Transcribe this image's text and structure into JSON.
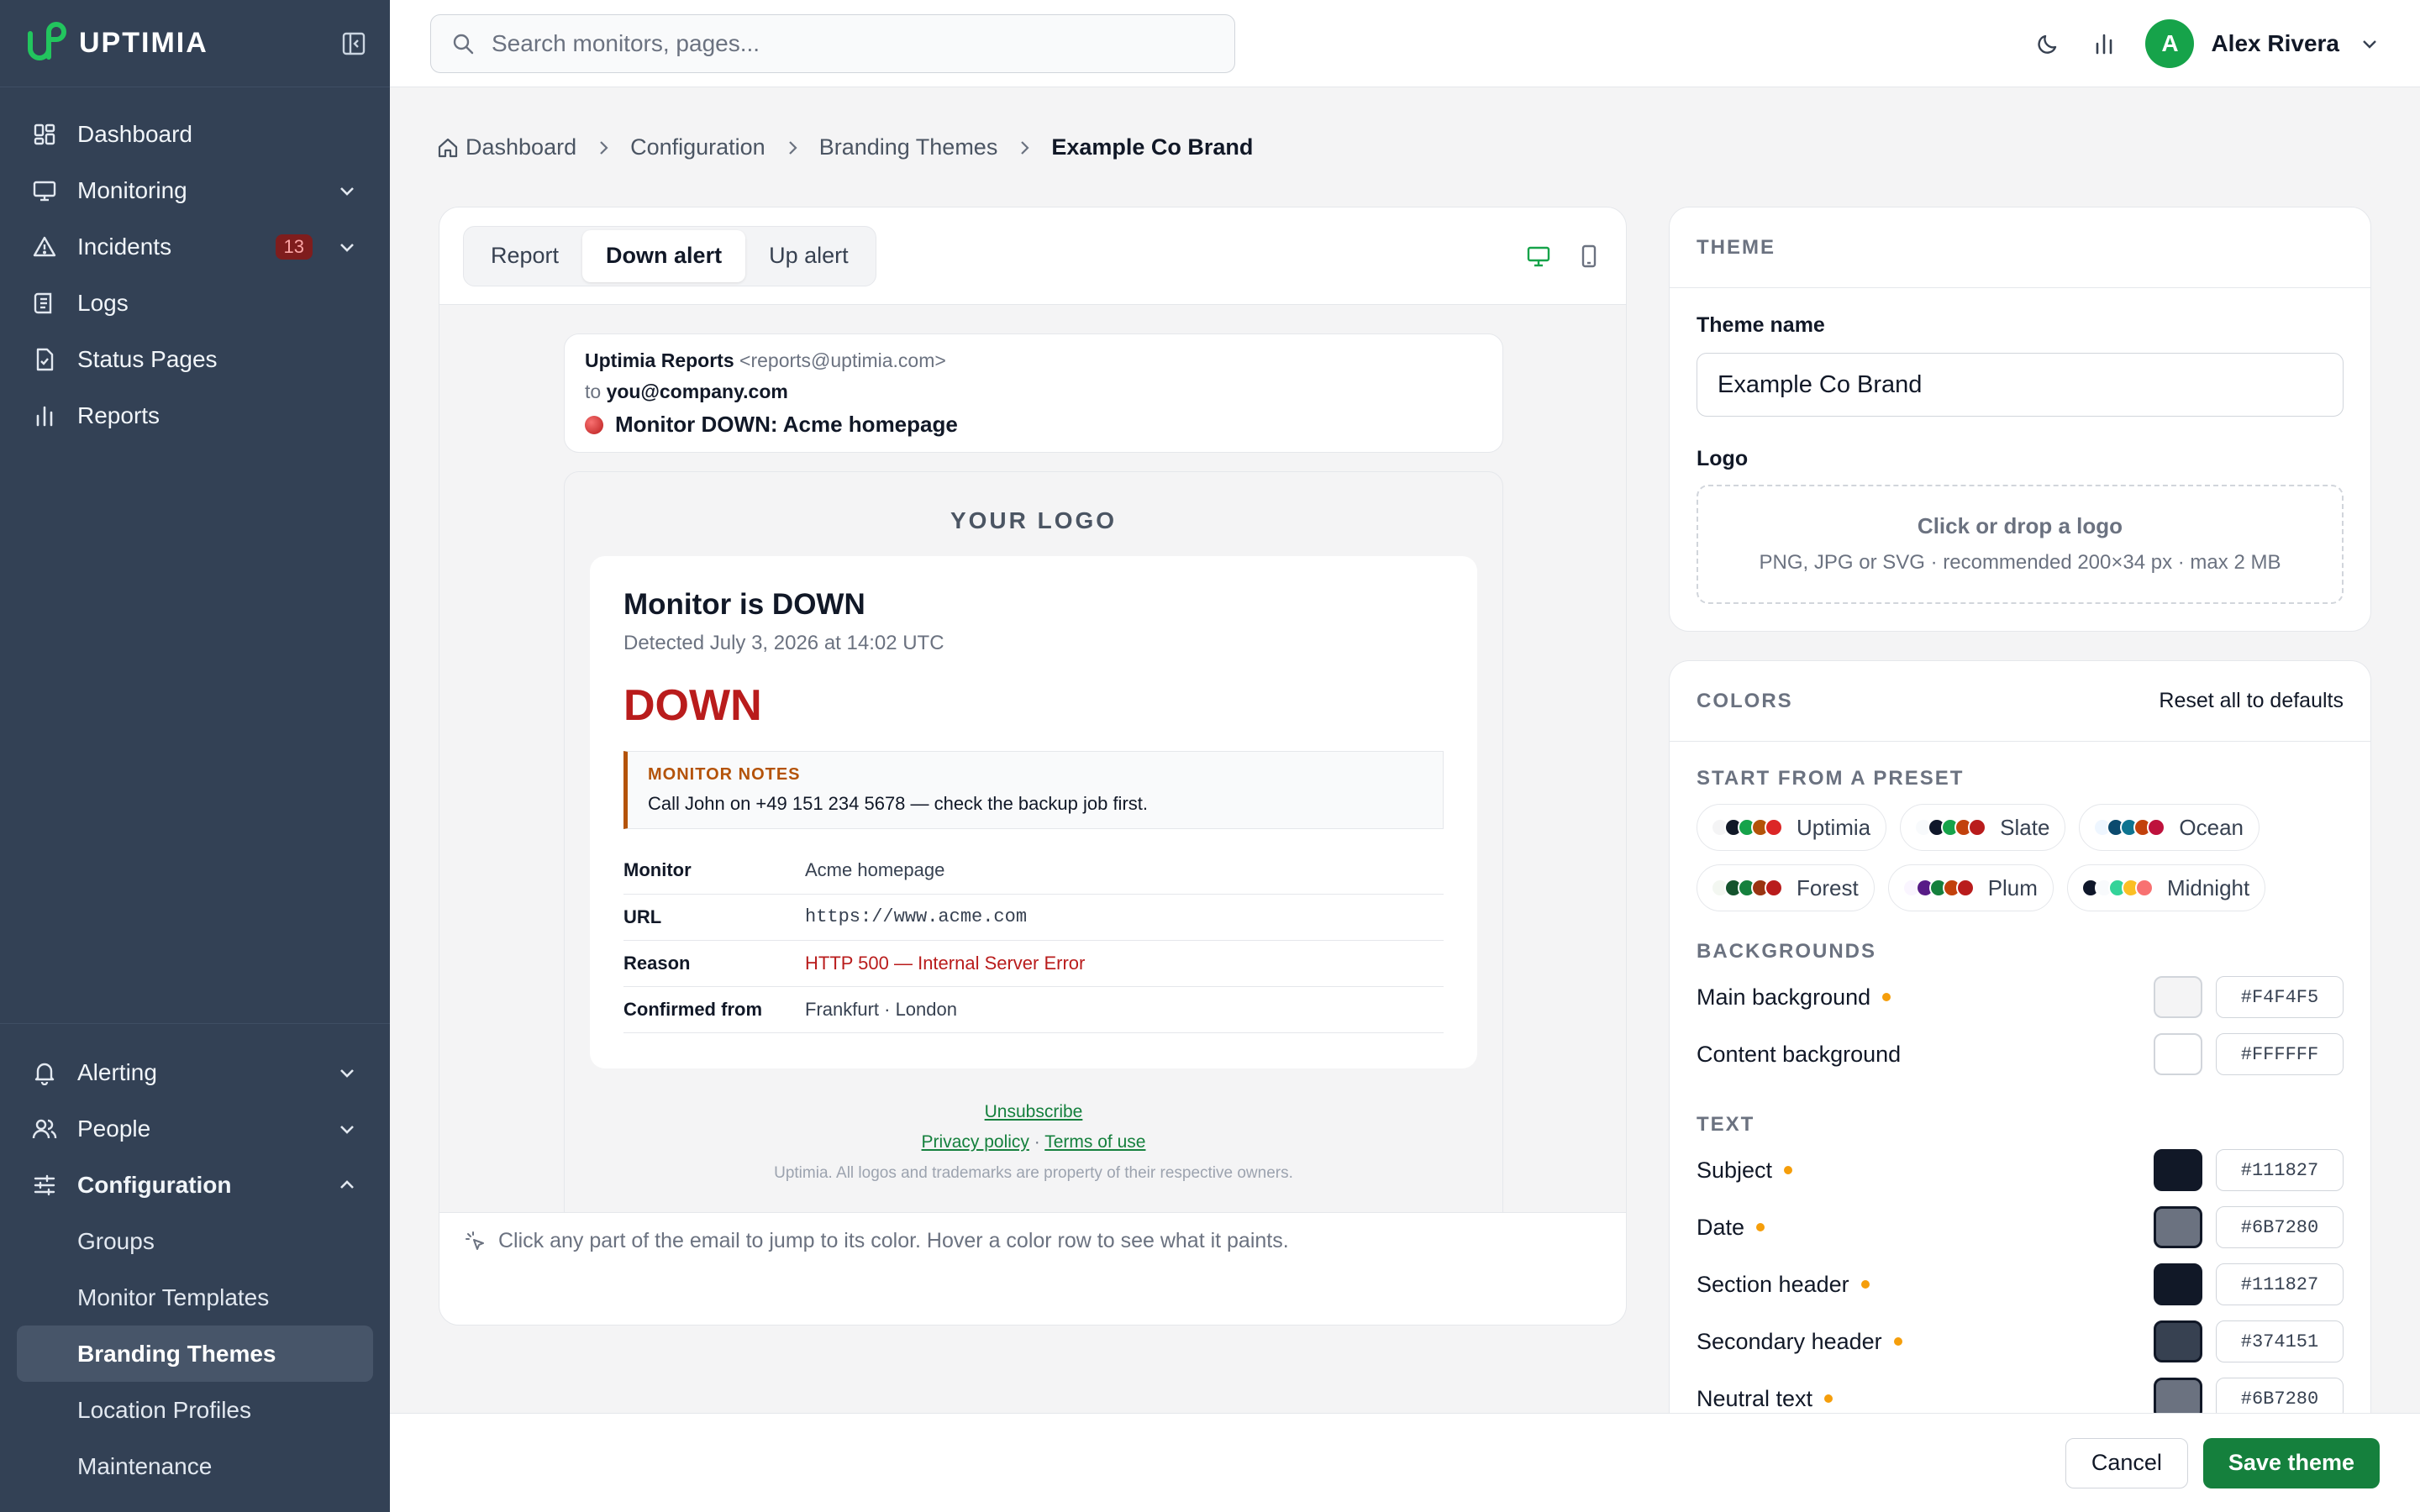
{
  "app": {
    "name": "UPTIMIA"
  },
  "sidebar": {
    "items": [
      {
        "label": "Dashboard",
        "icon": "dashboard-icon"
      },
      {
        "label": "Monitoring",
        "icon": "monitor-icon"
      },
      {
        "label": "Incidents",
        "icon": "warning-icon",
        "badge": "13"
      },
      {
        "label": "Logs",
        "icon": "logs-icon"
      },
      {
        "label": "Status Pages",
        "icon": "status-page-icon"
      },
      {
        "label": "Reports",
        "icon": "bar-chart-icon"
      }
    ],
    "bottom": [
      {
        "label": "Alerting",
        "icon": "bell-icon"
      },
      {
        "label": "People",
        "icon": "people-icon"
      },
      {
        "label": "Configuration",
        "icon": "sliders-icon"
      }
    ],
    "config_sub": [
      "Groups",
      "Monitor Templates",
      "Branding Themes",
      "Location Profiles",
      "Maintenance"
    ]
  },
  "topbar": {
    "search_placeholder": "Search monitors, pages...",
    "user_initial": "A",
    "user_name": "Alex Rivera"
  },
  "breadcrumb": [
    "Dashboard",
    "Configuration",
    "Branding Themes",
    "Example Co Brand"
  ],
  "preview": {
    "tabs": [
      "Report",
      "Down alert",
      "Up alert"
    ],
    "active_tab": "Down alert",
    "from_name": "Uptimia Reports",
    "from_email": "<reports@uptimia.com>",
    "to_prefix": "to",
    "to_email": "you@company.com",
    "subject": "Monitor DOWN: Acme homepage",
    "logo_placeholder": "YOUR LOGO",
    "title": "Monitor is DOWN",
    "detected": "Detected July 3, 2026 at 14:02 UTC",
    "status": "DOWN",
    "notes_header": "MONITOR NOTES",
    "notes_text": "Call John on +49 151 234 5678 — check the backup job first.",
    "rows": [
      {
        "key": "Monitor",
        "value": "Acme homepage"
      },
      {
        "key": "URL",
        "value": "https://www.acme.com"
      },
      {
        "key": "Reason",
        "value": "HTTP 500 — Internal Server Error"
      },
      {
        "key": "Confirmed from",
        "value": "Frankfurt · London"
      }
    ],
    "unsubscribe": "Unsubscribe",
    "privacy": "Privacy policy",
    "dot_sep": "·",
    "terms": "Terms of use",
    "legal": "Uptimia. All logos and trademarks are property of their respective owners.",
    "hint": "Click any part of the email to jump to its color. Hover a color row to see what it paints."
  },
  "theme": {
    "section_title": "THEME",
    "name_label": "Theme name",
    "name_value": "Example Co Brand",
    "logo_label": "Logo",
    "logo_drop_title": "Click or drop a logo",
    "logo_drop_hint": "PNG, JPG or SVG · recommended 200×34 px · max 2 MB"
  },
  "colors": {
    "section_title": "COLORS",
    "reset_label": "Reset all to defaults",
    "preset_label": "START FROM A PRESET",
    "presets": [
      {
        "name": "Uptimia",
        "dots": [
          "#f4f4f5",
          "#111827",
          "#16a34a",
          "#b45309",
          "#dc2626"
        ]
      },
      {
        "name": "Slate",
        "dots": [
          "#f8fafc",
          "#0f172a",
          "#16a34a",
          "#c2410c",
          "#b91c1c"
        ]
      },
      {
        "name": "Ocean",
        "dots": [
          "#eef6ff",
          "#0c4a6e",
          "#0e7490",
          "#c2410c",
          "#be123c"
        ]
      },
      {
        "name": "Forest",
        "dots": [
          "#f3f7f1",
          "#14532d",
          "#15803d",
          "#9a3412",
          "#b91c1c"
        ]
      },
      {
        "name": "Plum",
        "dots": [
          "#faf5ff",
          "#581c87",
          "#15803d",
          "#c2410c",
          "#b91c1c"
        ]
      },
      {
        "name": "Midnight",
        "dots": [
          "#0f172a",
          "#f8fafc",
          "#34d399",
          "#fbbf24",
          "#f87171"
        ]
      }
    ],
    "backgrounds_label": "BACKGROUNDS",
    "backgrounds": [
      {
        "label": "Main background",
        "hex": "#F4F4F5",
        "changed": true
      },
      {
        "label": "Content background",
        "hex": "#FFFFFF",
        "changed": false
      }
    ],
    "text_label": "TEXT",
    "text": [
      {
        "label": "Subject",
        "hex": "#111827",
        "changed": true
      },
      {
        "label": "Date",
        "hex": "#6B7280",
        "changed": true
      },
      {
        "label": "Section header",
        "hex": "#111827",
        "changed": true
      },
      {
        "label": "Secondary header",
        "hex": "#374151",
        "changed": true
      },
      {
        "label": "Neutral text",
        "hex": "#6B7280",
        "changed": true
      }
    ]
  },
  "actions": {
    "cancel": "Cancel",
    "save": "Save theme"
  },
  "palette": {
    "accent": "#15803d",
    "sidebar": "#334155",
    "danger": "#b91c1c",
    "note": "#b45309"
  }
}
